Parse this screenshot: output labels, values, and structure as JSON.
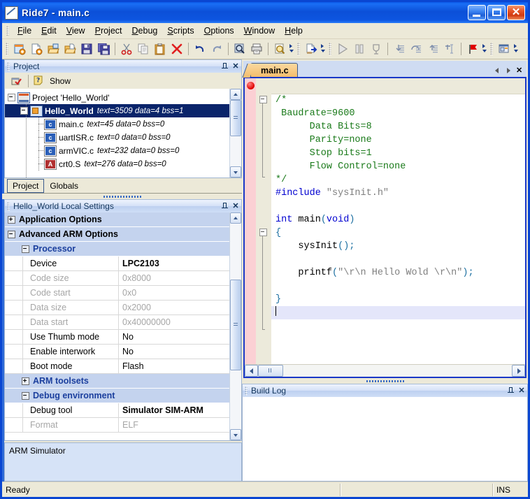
{
  "window": {
    "title": "Ride7 - main.c",
    "icon": "ride7-app-icon",
    "buttons": {
      "minimize": "minimize",
      "maximize": "maximize",
      "close": "close"
    }
  },
  "menu": {
    "items": [
      {
        "label": "File",
        "accel": "F"
      },
      {
        "label": "Edit",
        "accel": "E"
      },
      {
        "label": "View",
        "accel": "V"
      },
      {
        "label": "Project",
        "accel": "P"
      },
      {
        "label": "Debug",
        "accel": "D"
      },
      {
        "label": "Scripts",
        "accel": "S"
      },
      {
        "label": "Options",
        "accel": "O"
      },
      {
        "label": "Window",
        "accel": "W"
      },
      {
        "label": "Help",
        "accel": "H"
      }
    ]
  },
  "toolbar": {
    "groups": [
      [
        "new-project-icon",
        "new-file-icon",
        "open-project-icon",
        "open-file-icon",
        "save-icon",
        "save-all-icon"
      ],
      [
        "cut-icon",
        "copy-icon",
        "paste-icon",
        "delete-icon"
      ],
      [
        "undo-icon",
        "redo-icon"
      ],
      [
        "find-icon",
        "print-icon"
      ],
      [
        "print-preview-icon"
      ],
      [
        "build-icon"
      ],
      [
        "run-icon",
        "pause-icon",
        "stop-debug-icon"
      ],
      [
        "step-into-icon",
        "step-over-icon",
        "step-out-icon",
        "run-to-cursor-icon"
      ],
      [
        "breakpoint-flag-icon"
      ],
      [
        "workspace-icon"
      ]
    ]
  },
  "project_panel": {
    "title": "Project",
    "pin": "pin-icon",
    "close": "close-icon",
    "toolbar": {
      "options_icon": "project-options-icon",
      "help_icon": "help-icon",
      "show_label": "Show"
    },
    "tree": [
      {
        "level": 1,
        "expander": "minus",
        "icon": "project-icon",
        "name": "Project 'Hello_World'",
        "meta": "",
        "selected": false,
        "bold": false
      },
      {
        "level": 2,
        "expander": "minus",
        "icon": "target-icon",
        "name": "Hello_World",
        "meta": "text=3509 data=4 bss=1",
        "selected": true,
        "bold": true
      },
      {
        "level": 3,
        "expander": "none",
        "icon": "c-file-icon",
        "name": "main.c",
        "meta": "text=45 data=0 bss=0",
        "selected": false,
        "bold": false
      },
      {
        "level": 3,
        "expander": "none",
        "icon": "c-file-icon",
        "name": "uartISR.c",
        "meta": "text=0 data=0 bss=0",
        "selected": false,
        "bold": false
      },
      {
        "level": 3,
        "expander": "none",
        "icon": "c-file-icon",
        "name": "armVIC.c",
        "meta": "text=232 data=0 bss=0",
        "selected": false,
        "bold": false
      },
      {
        "level": 3,
        "expander": "none",
        "icon": "asm-file-icon",
        "name": "crt0.S",
        "meta": "text=276 data=0 bss=0",
        "selected": false,
        "bold": false
      }
    ],
    "tabs": [
      {
        "label": "Project",
        "active": true
      },
      {
        "label": "Globals",
        "active": false
      }
    ]
  },
  "settings_panel": {
    "title": "Hello_World Local Settings",
    "pin": "pin-icon",
    "close": "close-icon",
    "rows": [
      {
        "kind": "category",
        "expander": "plus",
        "label": "Application Options",
        "color": "black"
      },
      {
        "kind": "category",
        "expander": "minus",
        "label": "Advanced ARM Options",
        "color": "black"
      },
      {
        "kind": "subcategory",
        "expander": "minus",
        "label": "Processor",
        "color": "blue"
      },
      {
        "kind": "property",
        "name": "Device",
        "value": "LPC2103",
        "dim": false,
        "bold": true
      },
      {
        "kind": "property",
        "name": "Code size",
        "value": "0x8000",
        "dim": true,
        "bold": false
      },
      {
        "kind": "property",
        "name": "Code start",
        "value": "0x0",
        "dim": true,
        "bold": false
      },
      {
        "kind": "property",
        "name": "Data size",
        "value": "0x2000",
        "dim": true,
        "bold": false
      },
      {
        "kind": "property",
        "name": "Data start",
        "value": "0x40000000",
        "dim": true,
        "bold": false
      },
      {
        "kind": "property",
        "name": "Use Thumb mode",
        "value": "No",
        "dim": false,
        "bold": false
      },
      {
        "kind": "property",
        "name": "Enable interwork",
        "value": "No",
        "dim": false,
        "bold": false
      },
      {
        "kind": "property",
        "name": "Boot mode",
        "value": "Flash",
        "dim": false,
        "bold": false
      },
      {
        "kind": "subcategory",
        "expander": "plus",
        "label": "ARM toolsets",
        "color": "blue"
      },
      {
        "kind": "subcategory",
        "expander": "minus",
        "label": "Debug environment",
        "color": "blue"
      },
      {
        "kind": "property",
        "name": "Debug tool",
        "value": "Simulator SIM-ARM",
        "dim": false,
        "bold": true
      },
      {
        "kind": "property",
        "name": "Format",
        "value": "ELF",
        "dim": true,
        "bold": false
      }
    ],
    "description": "ARM Simulator"
  },
  "editor": {
    "tabs": [
      {
        "label": "main.c",
        "active": true
      }
    ],
    "nav": {
      "prev": "chevron-left-icon",
      "next": "chevron-right-icon",
      "close": "close-icon"
    },
    "breakpoint_line": 0,
    "cursor_line": 14,
    "code": [
      {
        "n": 1,
        "segs": [
          {
            "t": "/*",
            "c": "cm"
          }
        ],
        "fold": "start"
      },
      {
        "n": 2,
        "segs": [
          {
            "t": " Baudrate=9600",
            "c": "cm"
          }
        ]
      },
      {
        "n": 3,
        "segs": [
          {
            "t": "      Data Bits=8",
            "c": "cm"
          }
        ]
      },
      {
        "n": 4,
        "segs": [
          {
            "t": "      Parity=none",
            "c": "cm"
          }
        ]
      },
      {
        "n": 5,
        "segs": [
          {
            "t": "      Stop bits=1",
            "c": "cm"
          }
        ]
      },
      {
        "n": 6,
        "segs": [
          {
            "t": "      Flow Control=none",
            "c": "cm"
          }
        ]
      },
      {
        "n": 7,
        "segs": [
          {
            "t": "*/",
            "c": "cm"
          }
        ],
        "fold": "end"
      },
      {
        "n": 8,
        "segs": [
          {
            "t": "#include ",
            "c": "kw"
          },
          {
            "t": "\"sysInit.h\"",
            "c": "st"
          }
        ]
      },
      {
        "n": 9,
        "segs": []
      },
      {
        "n": 10,
        "segs": [
          {
            "t": "int ",
            "c": "kw"
          },
          {
            "t": "main",
            "c": "id"
          },
          {
            "t": "(",
            "c": "pn"
          },
          {
            "t": "void",
            "c": "kw"
          },
          {
            "t": ")",
            "c": "pn"
          }
        ]
      },
      {
        "n": 11,
        "segs": [
          {
            "t": "{",
            "c": "pn"
          }
        ],
        "fold": "start"
      },
      {
        "n": 12,
        "segs": [
          {
            "t": "    sysInit",
            "c": "id"
          },
          {
            "t": "();",
            "c": "pn"
          }
        ]
      },
      {
        "n": 13,
        "segs": []
      },
      {
        "n": 14,
        "segs": [
          {
            "t": "    printf",
            "c": "id"
          },
          {
            "t": "(",
            "c": "pn"
          },
          {
            "t": "\"\\r\\n Hello Wold \\r\\n\"",
            "c": "st"
          },
          {
            "t": ");",
            "c": "pn"
          }
        ]
      },
      {
        "n": 15,
        "segs": []
      },
      {
        "n": 16,
        "segs": [
          {
            "t": "}",
            "c": "pn"
          }
        ],
        "fold": "end"
      },
      {
        "n": 17,
        "segs": [],
        "current": true
      }
    ]
  },
  "build_log": {
    "title": "Build Log",
    "pin": "pin-icon",
    "close": "close-icon",
    "content": ""
  },
  "statusbar": {
    "message": "Ready",
    "insert_mode": "INS"
  },
  "colors": {
    "titlebar": "#0c50d8",
    "accent_border": "#2f6bd8",
    "selection": "#0a246a",
    "category_header": "#c4d3ee",
    "tab_active": "#f3bd6c",
    "breakpoint": "#e00000",
    "comment": "#1a7a1a",
    "keyword": "#0000d0",
    "string": "#808080",
    "chrome": "#ece9d8"
  }
}
